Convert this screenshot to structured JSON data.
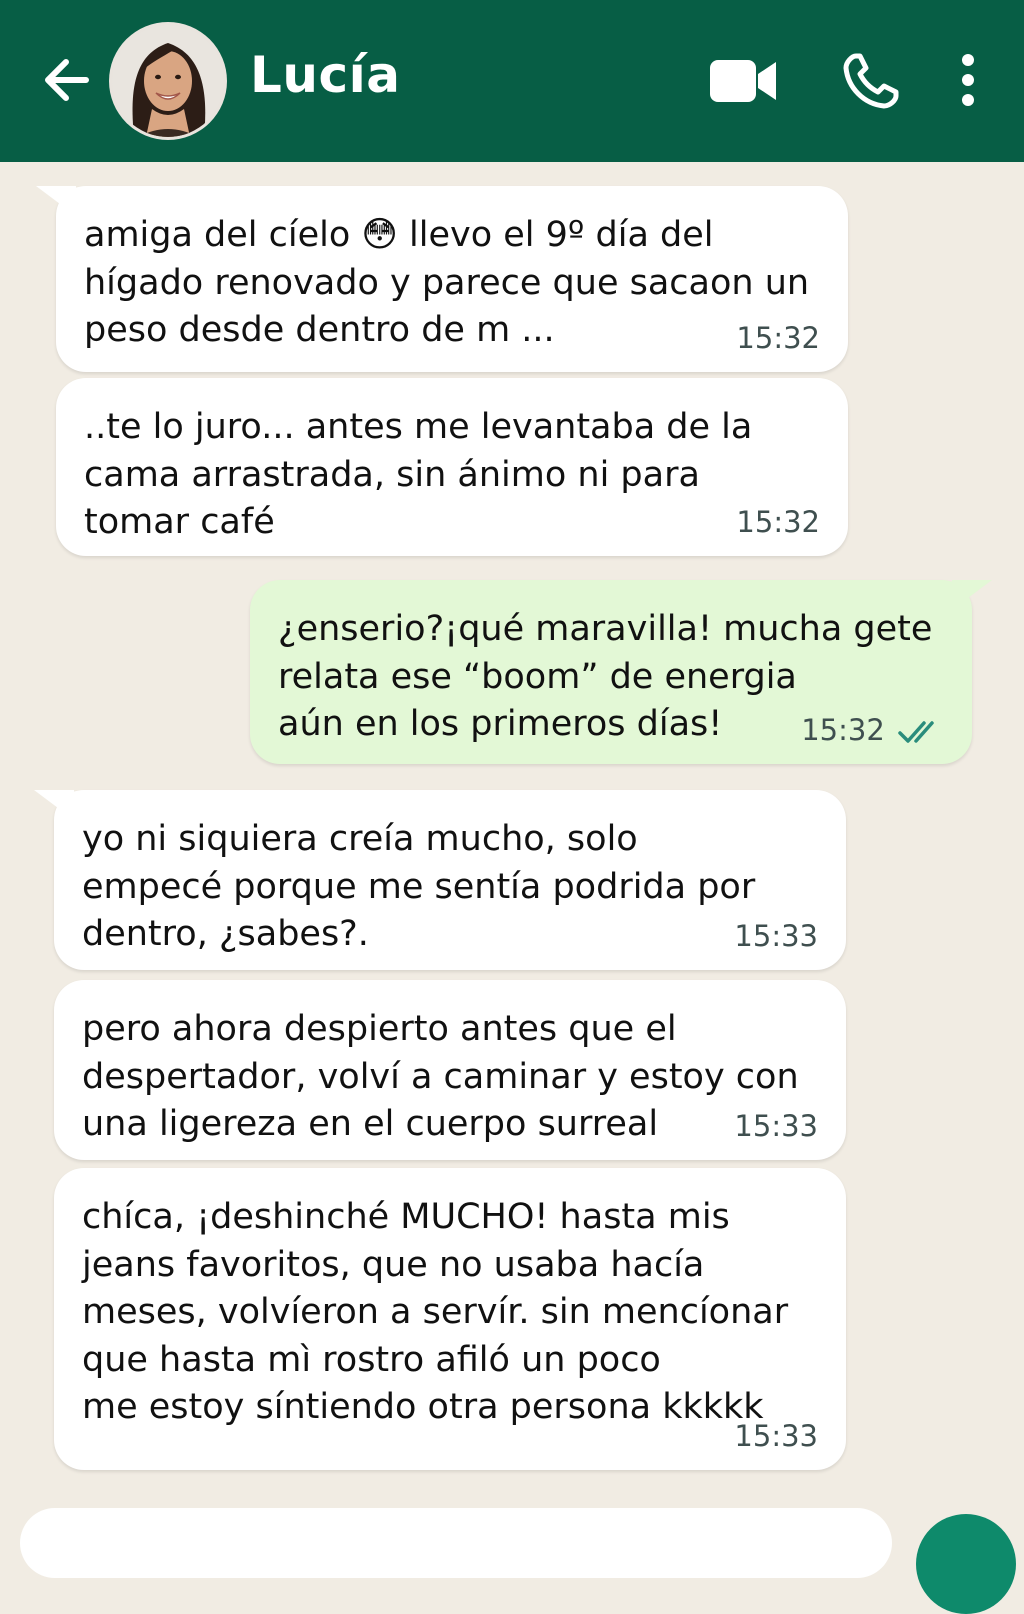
{
  "header": {
    "contact_name": "Lucía",
    "background_color": "#075e45"
  },
  "messages": [
    {
      "direction": "incoming",
      "text": "amiga del cíelo 😳 llevo el 9º día del\nhígado renovado y parece que sacaon un\npeso desde dentro de m ...",
      "time": "15:32"
    },
    {
      "direction": "incoming",
      "text": "..te lo juro... antes me levantaba de la\ncama arrastrada, sin ánimo ni para\ntomar café",
      "time": "15:32"
    },
    {
      "direction": "outgoing",
      "text": "¿enserio?¡qué maravilla! mucha gete\nrelata ese “boom” de energia\naún en los primeros días!",
      "time": "15:32",
      "status": "read"
    },
    {
      "direction": "incoming",
      "text": "yo ni siquiera creía mucho, solo\nempecé porque me sentía podrida por\ndentro, ¿sabes?.",
      "time": "15:33"
    },
    {
      "direction": "incoming",
      "text": "pero ahora despierto antes que el\ndespertador, volví a caminar y estoy con\nuna ligereza en el cuerpo surreal",
      "time": "15:33"
    },
    {
      "direction": "incoming",
      "text": "chíca, ¡deshinché MUCHO! hasta mis\njeans favoritos, que no usaba hacía\nmeses, volvíeron a servír. sin mencíonar\nque hasta mì rostro afiló un poco\nme estoy síntiendo otra persona  kkkkk",
      "time": "15:33"
    }
  ],
  "colors": {
    "chat_background": "#f1ece3",
    "incoming_bubble": "#ffffff",
    "outgoing_bubble": "#e3f8d6",
    "read_check": "#2a8d7c"
  },
  "icons": [
    "back-arrow-icon",
    "avatar",
    "video-call-icon",
    "phone-icon",
    "more-vert-icon",
    "double-check-icon"
  ]
}
